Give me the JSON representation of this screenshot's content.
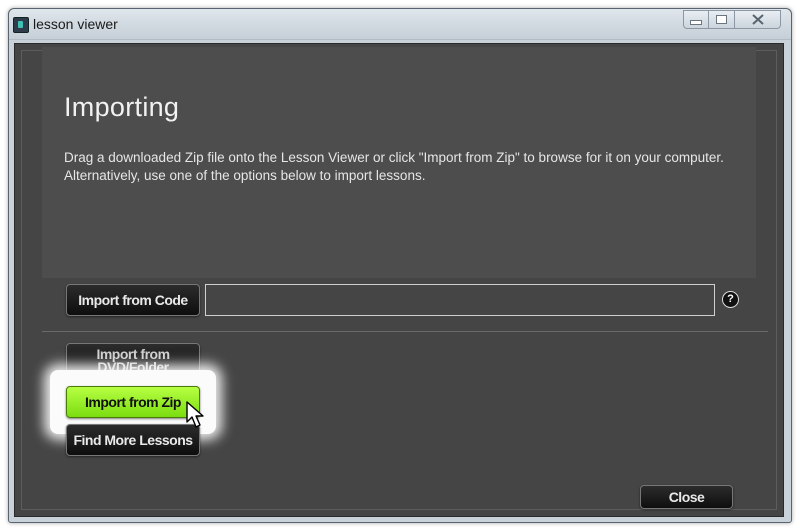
{
  "window": {
    "title": "lesson viewer",
    "controls": [
      "minimize-icon",
      "maximize-icon",
      "close-icon"
    ]
  },
  "main": {
    "heading": "Importing",
    "description": "Drag a downloaded Zip file onto the Lesson Viewer or click \"Import from Zip\" to browse for it on your computer. Alternatively, use one of the options below to import lessons.",
    "code_input_value": ""
  },
  "buttons": {
    "import_from_code": "Import from Code",
    "import_from_dvd_line1": "Import from",
    "import_from_dvd_line2": "DVD/Folder",
    "import_from_zip": "Import from Zip",
    "find_more_lessons": "Find More Lessons",
    "close": "Close"
  },
  "help_icon_glyph": "?",
  "colors": {
    "accent_green": "#9cf02a",
    "panel_dark": "#454545"
  }
}
